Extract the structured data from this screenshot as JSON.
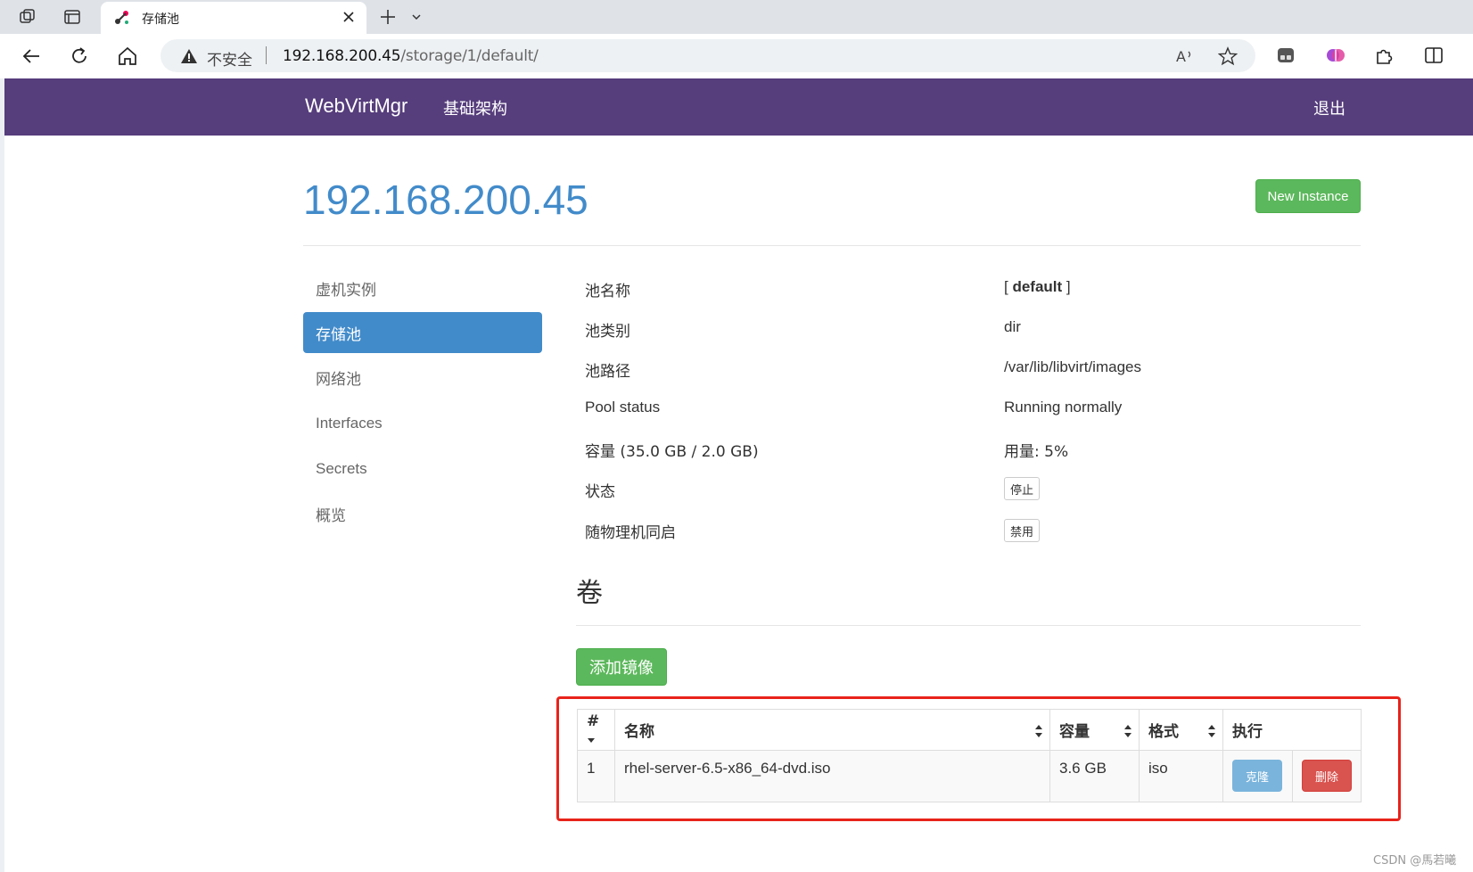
{
  "browser": {
    "tab_title": "存储池",
    "security_label": "不安全",
    "url_host": "192.168.200.45",
    "url_path": "/storage/1/default/"
  },
  "navbar": {
    "brand": "WebVirtMgr",
    "infrastructure_link": "基础架构",
    "logout_link": "退出",
    "background_color": "#563d7c"
  },
  "header": {
    "host_title": "192.168.200.45",
    "new_instance_button": "New Instance"
  },
  "sidebar": {
    "items": [
      {
        "label": "虚机实例",
        "active": false
      },
      {
        "label": "存储池",
        "active": true
      },
      {
        "label": "网络池",
        "active": false
      },
      {
        "label": "Interfaces",
        "active": false
      },
      {
        "label": "Secrets",
        "active": false
      },
      {
        "label": "概览",
        "active": false
      }
    ]
  },
  "pool": {
    "name_label": "池名称",
    "name_value_prefix": "[ ",
    "name_value": "default",
    "name_value_suffix": " ]",
    "type_label": "池类别",
    "type_value": "dir",
    "path_label": "池路径",
    "path_value": "/var/lib/libvirt/images",
    "status_label": "Pool status",
    "status_value": "Running normally",
    "capacity_label": "容量 (35.0 GB / 2.0 GB)",
    "usage_value": "用量: 5%",
    "state_label": "状态",
    "stop_button": "停止",
    "autostart_label": "随物理机同启",
    "disable_button": "禁用"
  },
  "volumes": {
    "title": "卷",
    "add_image_button": "添加镜像",
    "columns": [
      "#",
      "名称",
      "容量",
      "格式",
      "执行"
    ],
    "rows": [
      {
        "index": "1",
        "name": "rhel-server-6.5-x86_64-dvd.iso",
        "size": "3.6 GB",
        "format": "iso",
        "clone_button": "克隆",
        "delete_button": "删除"
      }
    ]
  },
  "watermark": "CSDN @馬若曦",
  "colors": {
    "accent": "#428bca",
    "success": "#5cb85c",
    "danger": "#d9534f",
    "highlight_border": "#e8231b"
  }
}
